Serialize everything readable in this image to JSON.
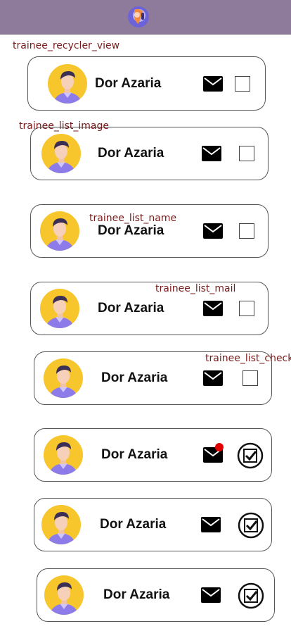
{
  "colors": {
    "topbar": "#8e7a9a",
    "annotation": "#7a1a1a",
    "notification_dot": "#e00000",
    "avatar_bg": "#f7c52c",
    "shirt": "#8e7bea"
  },
  "annotations": {
    "recycler": "trainee_recycler_view",
    "image": "trainee_list_image",
    "name": "trainee_list_name",
    "mail": "trainee_list_mail",
    "check": "trainee_list_check"
  },
  "trainees": [
    {
      "name": "Dor Azaria",
      "checked": false,
      "unread": false
    },
    {
      "name": "Dor Azaria",
      "checked": false,
      "unread": false
    },
    {
      "name": "Dor Azaria",
      "checked": false,
      "unread": false
    },
    {
      "name": "Dor Azaria",
      "checked": false,
      "unread": false
    },
    {
      "name": "Dor Azaria",
      "checked": false,
      "unread": false
    },
    {
      "name": "Dor Azaria",
      "checked": true,
      "unread": true
    },
    {
      "name": "Dor Azaria",
      "checked": true,
      "unread": false
    },
    {
      "name": "Dor Azaria",
      "checked": true,
      "unread": false
    }
  ]
}
